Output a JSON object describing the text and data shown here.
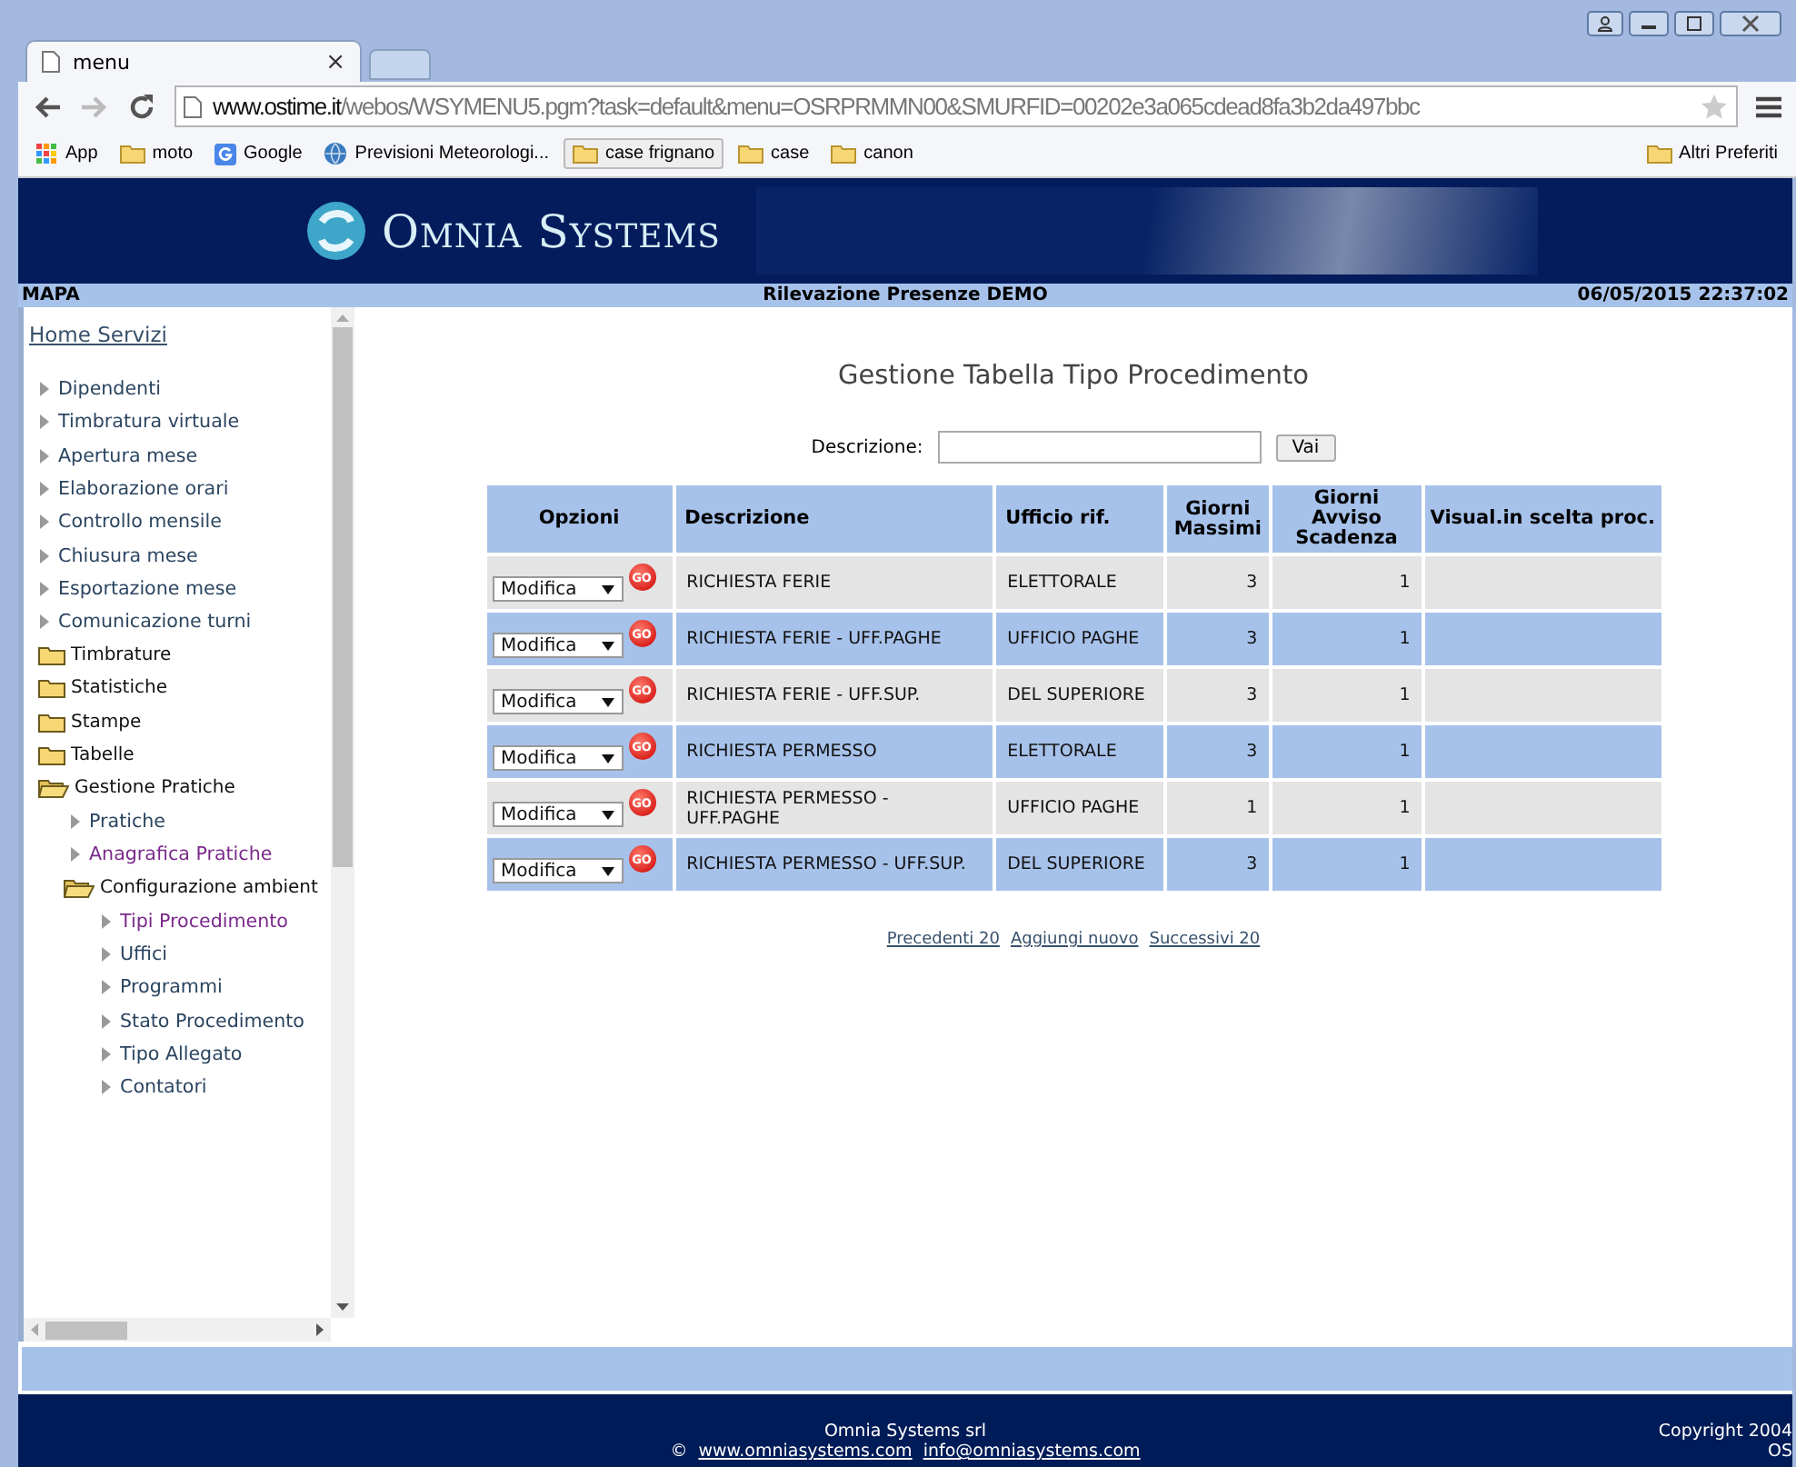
{
  "browser": {
    "tab_title": "menu",
    "tab_close": "×",
    "url_host": "www.ostime.it",
    "url_path": "/webos/WSYMENU5.pgm?task=default&menu=OSRPRMMN00&SMURFID=00202e3a065cdead8fa3b2da497bbc",
    "bookmarks": [
      {
        "label": "App",
        "kind": "apps"
      },
      {
        "label": "moto",
        "kind": "folder"
      },
      {
        "label": "Google",
        "kind": "google"
      },
      {
        "label": "Previsioni Meteorologi...",
        "kind": "globe"
      },
      {
        "label": "case frignano",
        "kind": "folder"
      },
      {
        "label": "case",
        "kind": "folder"
      },
      {
        "label": "canon",
        "kind": "folder"
      }
    ],
    "other_bookmarks": "Altri Preferiti"
  },
  "banner": {
    "logo": "Omnia Systems"
  },
  "info_bar": {
    "left": "MAPA",
    "center": "Rilevazione Presenze DEMO",
    "right": "06/05/2015 22:37:02"
  },
  "sidebar": {
    "home": "Home Servizi",
    "items": [
      {
        "label": "Dipendenti",
        "kind": "leaf",
        "visited": false
      },
      {
        "label": "Timbratura virtuale",
        "kind": "leaf",
        "visited": false
      },
      {
        "label": "Apertura mese",
        "kind": "leaf",
        "visited": false
      },
      {
        "label": "Elaborazione orari",
        "kind": "leaf",
        "visited": false
      },
      {
        "label": "Controllo mensile",
        "kind": "leaf",
        "visited": false
      },
      {
        "label": "Chiusura mese",
        "kind": "leaf",
        "visited": false
      },
      {
        "label": "Esportazione mese",
        "kind": "leaf",
        "visited": false
      },
      {
        "label": "Comunicazione turni",
        "kind": "leaf",
        "visited": false
      },
      {
        "label": "Timbrature",
        "kind": "folder",
        "expanded": false
      },
      {
        "label": "Statistiche",
        "kind": "folder",
        "expanded": false
      },
      {
        "label": "Stampe",
        "kind": "folder",
        "expanded": false
      },
      {
        "label": "Tabelle",
        "kind": "folder",
        "expanded": false
      },
      {
        "label": "Gestione Pratiche",
        "kind": "folder",
        "expanded": true,
        "children": [
          {
            "label": "Pratiche",
            "kind": "leaf",
            "visited": false
          },
          {
            "label": "Anagrafica Pratiche",
            "kind": "leaf",
            "visited": true
          },
          {
            "label": "Configurazione ambient",
            "kind": "folder",
            "expanded": true,
            "children": [
              {
                "label": "Tipi Procedimento",
                "kind": "leaf",
                "visited": true
              },
              {
                "label": "Uffici",
                "kind": "leaf",
                "visited": false
              },
              {
                "label": "Programmi",
                "kind": "leaf",
                "visited": false
              },
              {
                "label": "Stato Procedimento",
                "kind": "leaf",
                "visited": false
              },
              {
                "label": "Tipo Allegato",
                "kind": "leaf",
                "visited": false
              },
              {
                "label": "Contatori",
                "kind": "leaf",
                "visited": false
              }
            ]
          }
        ]
      }
    ]
  },
  "content": {
    "title": "Gestione Tabella Tipo Procedimento",
    "search_label": "Descrizione:",
    "search_button": "Vai",
    "table": {
      "columns": [
        "Opzioni",
        "Descrizione",
        "Ufficio rif.",
        "Giorni Massimi",
        "Giorni Avviso Scadenza",
        "Visual.in scelta proc."
      ],
      "rows": [
        {
          "option": "Modifica",
          "go": "GO",
          "description": "RICHIESTA FERIE",
          "office": "ELETTORALE",
          "max_days": "3",
          "notice_days": "1"
        },
        {
          "option": "Modifica",
          "go": "GO",
          "description": "RICHIESTA FERIE - UFF.PAGHE",
          "office": "UFFICIO PAGHE",
          "max_days": "3",
          "notice_days": "1"
        },
        {
          "option": "Modifica",
          "go": "GO",
          "description": "RICHIESTA FERIE - UFF.SUP.",
          "office": "DEL SUPERIORE",
          "max_days": "3",
          "notice_days": "1"
        },
        {
          "option": "Modifica",
          "go": "GO",
          "description": "RICHIESTA PERMESSO",
          "office": "ELETTORALE",
          "max_days": "3",
          "notice_days": "1"
        },
        {
          "option": "Modifica",
          "go": "GO",
          "description": "RICHIESTA PERMESSO - UFF.PAGHE",
          "office": "UFFICIO PAGHE",
          "max_days": "1",
          "notice_days": "1"
        },
        {
          "option": "Modifica",
          "go": "GO",
          "description": "RICHIESTA PERMESSO - UFF.SUP.",
          "office": "DEL SUPERIORE",
          "max_days": "3",
          "notice_days": "1"
        }
      ]
    },
    "pager": [
      "Precedenti 20",
      "Aggiungi nuovo",
      "Successivi 20"
    ]
  },
  "footer": {
    "company": "Omnia Systems srl",
    "copyright_sign": "©",
    "links": [
      "www.omniasystems.com",
      "info@omniasystems.com"
    ],
    "copyright": "Copyright 2004",
    "copyright_short": "OS"
  }
}
